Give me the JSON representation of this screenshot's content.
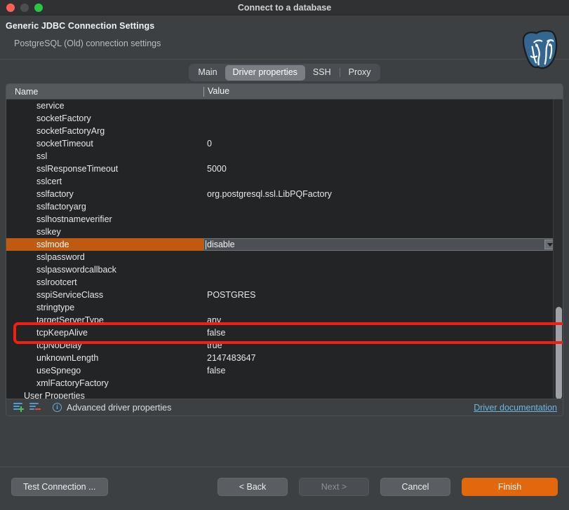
{
  "window": {
    "title": "Connect to a database",
    "traffic_lights": [
      "close-button",
      "minimize-button",
      "zoom-button"
    ]
  },
  "header": {
    "title": "Generic JDBC Connection Settings",
    "subtitle": "PostgreSQL (Old) connection settings",
    "logo": "postgresql-elephant-logo"
  },
  "tabs": [
    {
      "label": "Main",
      "selected": false
    },
    {
      "label": "Driver properties",
      "selected": true
    },
    {
      "label": "SSH",
      "selected": false
    },
    {
      "label": "Proxy",
      "selected": false
    }
  ],
  "table": {
    "columns": [
      "Name",
      "Value"
    ],
    "rows": [
      {
        "name": "service",
        "value": ""
      },
      {
        "name": "socketFactory",
        "value": ""
      },
      {
        "name": "socketFactoryArg",
        "value": ""
      },
      {
        "name": "socketTimeout",
        "value": "0"
      },
      {
        "name": "ssl",
        "value": ""
      },
      {
        "name": "sslResponseTimeout",
        "value": "5000"
      },
      {
        "name": "sslcert",
        "value": ""
      },
      {
        "name": "sslfactory",
        "value": "org.postgresql.ssl.LibPQFactory"
      },
      {
        "name": "sslfactoryarg",
        "value": ""
      },
      {
        "name": "sslhostnameverifier",
        "value": ""
      },
      {
        "name": "sslkey",
        "value": ""
      },
      {
        "name": "sslmode",
        "value": "disable"
      },
      {
        "name": "sslpassword",
        "value": ""
      },
      {
        "name": "sslpasswordcallback",
        "value": ""
      },
      {
        "name": "sslrootcert",
        "value": ""
      },
      {
        "name": "sspiServiceClass",
        "value": "POSTGRES"
      },
      {
        "name": "stringtype",
        "value": ""
      },
      {
        "name": "targetServerType",
        "value": "any"
      },
      {
        "name": "tcpKeepAlive",
        "value": "false"
      },
      {
        "name": "tcpNoDelay",
        "value": "true"
      },
      {
        "name": "unknownLength",
        "value": "2147483647"
      },
      {
        "name": "useSpnego",
        "value": "false"
      },
      {
        "name": "xmlFactoryFactory",
        "value": ""
      }
    ],
    "group_row": {
      "name": "User Properties",
      "value": ""
    },
    "selected_row_name": "sslmode",
    "editor": {
      "value": "disable",
      "control": "combo-box"
    },
    "annotation": {
      "color": "#f41f14",
      "target": "sslmode-row"
    }
  },
  "panel_footer": {
    "add_label": "add-property-icon",
    "remove_label": "remove-property-icon",
    "info_glyph": "i",
    "advanced_label": "Advanced driver properties",
    "doc_link": "Driver documentation"
  },
  "buttons": {
    "test": "Test Connection ...",
    "back": "< Back",
    "next": "Next >",
    "cancel": "Cancel",
    "finish": "Finish"
  },
  "colors": {
    "selection_orange": "#bf5a10",
    "primary_orange": "#e2670d",
    "link_blue": "#6fb3e0",
    "annotation_red": "#f41f14"
  }
}
